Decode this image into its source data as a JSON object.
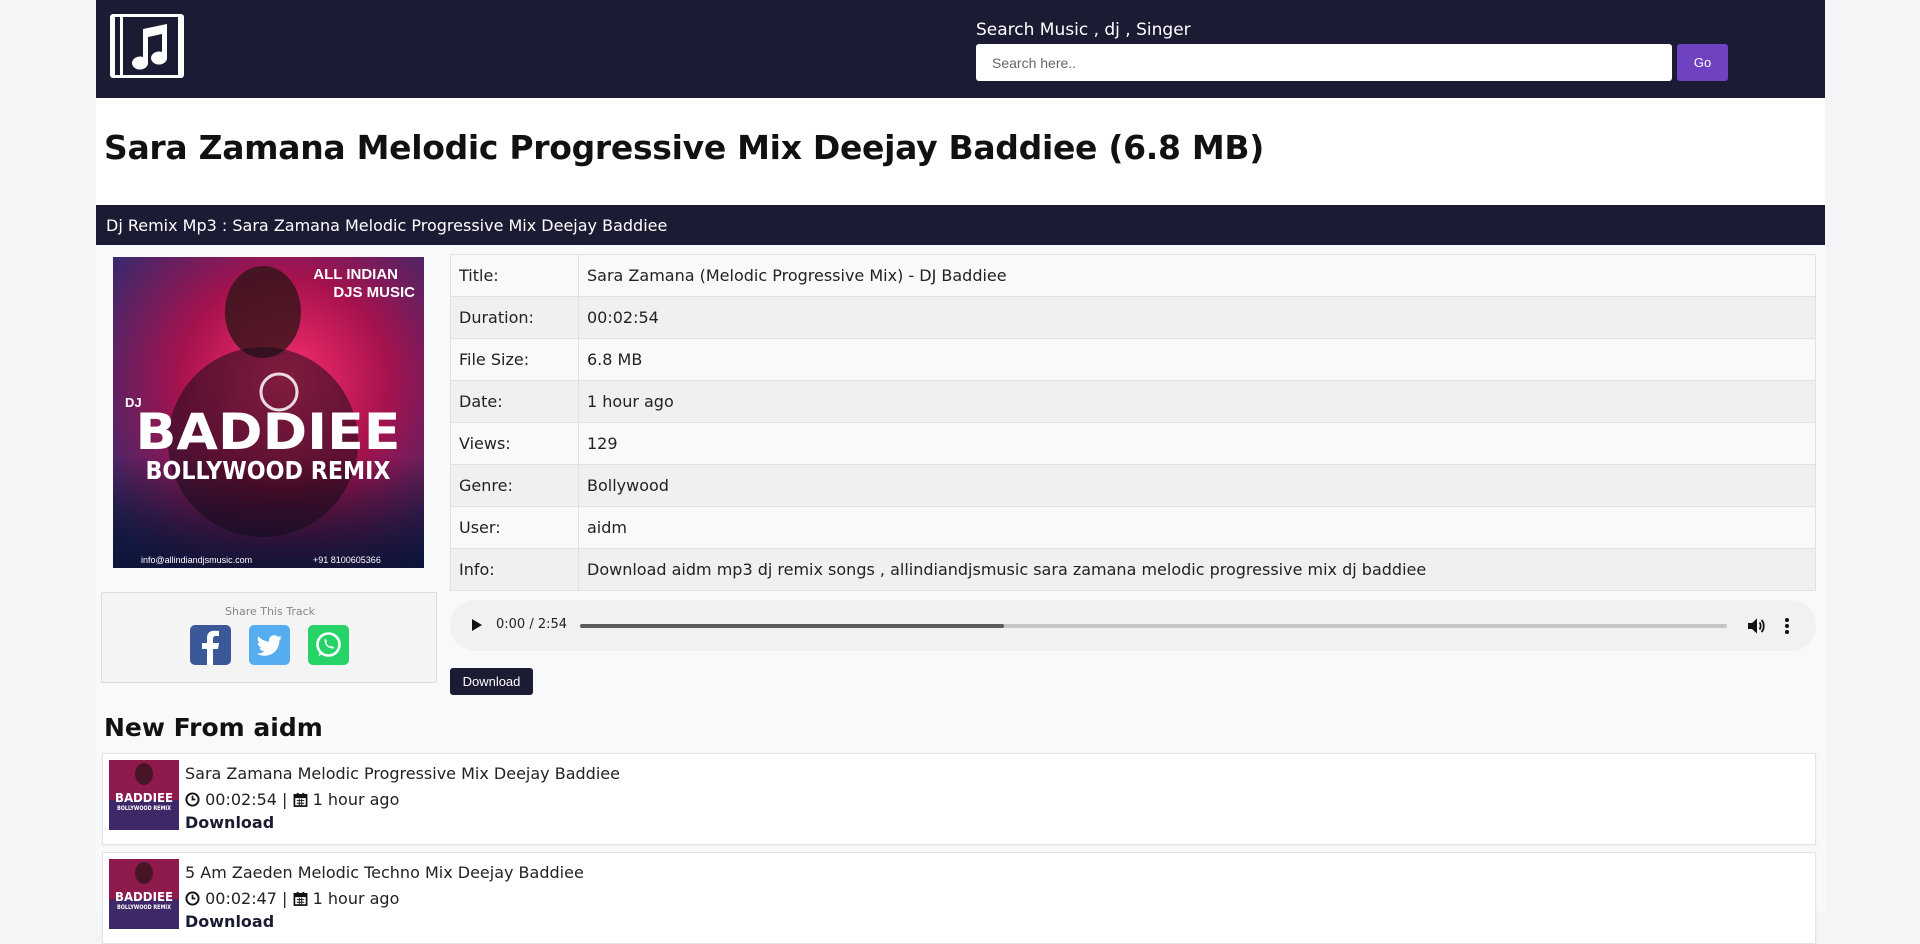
{
  "header": {
    "logo_icon": "music-note-icon",
    "search_label": "Search Music , dj , Singer",
    "search_placeholder": "Search here..",
    "go_label": "Go"
  },
  "title": "Sara Zamana Melodic Progressive Mix Deejay Baddiee (6.8 MB)",
  "breadcrumb": "Dj Remix Mp3 : Sara Zamana Melodic Progressive Mix Deejay Baddiee",
  "cover": {
    "brand_line1": "ALL INDIAN",
    "brand_line2": "DJS MUSIC",
    "dj": "DJ",
    "name": "BADDIEE",
    "subtitle": "BOLLYWOOD REMIX",
    "email": "info@allindiandjsmusic.com",
    "phone": "+91 8100605366"
  },
  "share": {
    "title": "Share This Track",
    "icons": [
      "facebook-icon",
      "twitter-icon",
      "whatsapp-icon"
    ]
  },
  "info": {
    "rows": [
      {
        "label": "Title:",
        "value": "Sara Zamana (Melodic Progressive Mix) - DJ Baddiee"
      },
      {
        "label": "Duration:",
        "value": "00:02:54"
      },
      {
        "label": "File Size:",
        "value": "6.8 MB"
      },
      {
        "label": "Date:",
        "value": "1 hour ago"
      },
      {
        "label": "Views:",
        "value": "129"
      },
      {
        "label": "Genre:",
        "value": "Bollywood"
      },
      {
        "label": "User:",
        "value": "aidm"
      },
      {
        "label": "Info:",
        "value": "Download aidm mp3 dj remix songs , allindiandjsmusic sara zamana melodic progressive mix dj baddiee"
      }
    ]
  },
  "player": {
    "time": "0:00 / 2:54",
    "buffered_fraction": 0.37
  },
  "download_label": "Download",
  "section_title": "New From aidm",
  "tracks": [
    {
      "title": "Sara Zamana Melodic Progressive Mix Deejay Baddiee",
      "duration": "00:02:54",
      "separator": "|",
      "date": "1 hour ago",
      "download": "Download"
    },
    {
      "title": "5 Am Zaeden Melodic Techno Mix Deejay Baddiee",
      "duration": "00:02:47",
      "separator": "|",
      "date": "1 hour ago",
      "download": "Download"
    }
  ],
  "colors": {
    "navy": "#1b1c33",
    "accent": "#6f42c1"
  }
}
